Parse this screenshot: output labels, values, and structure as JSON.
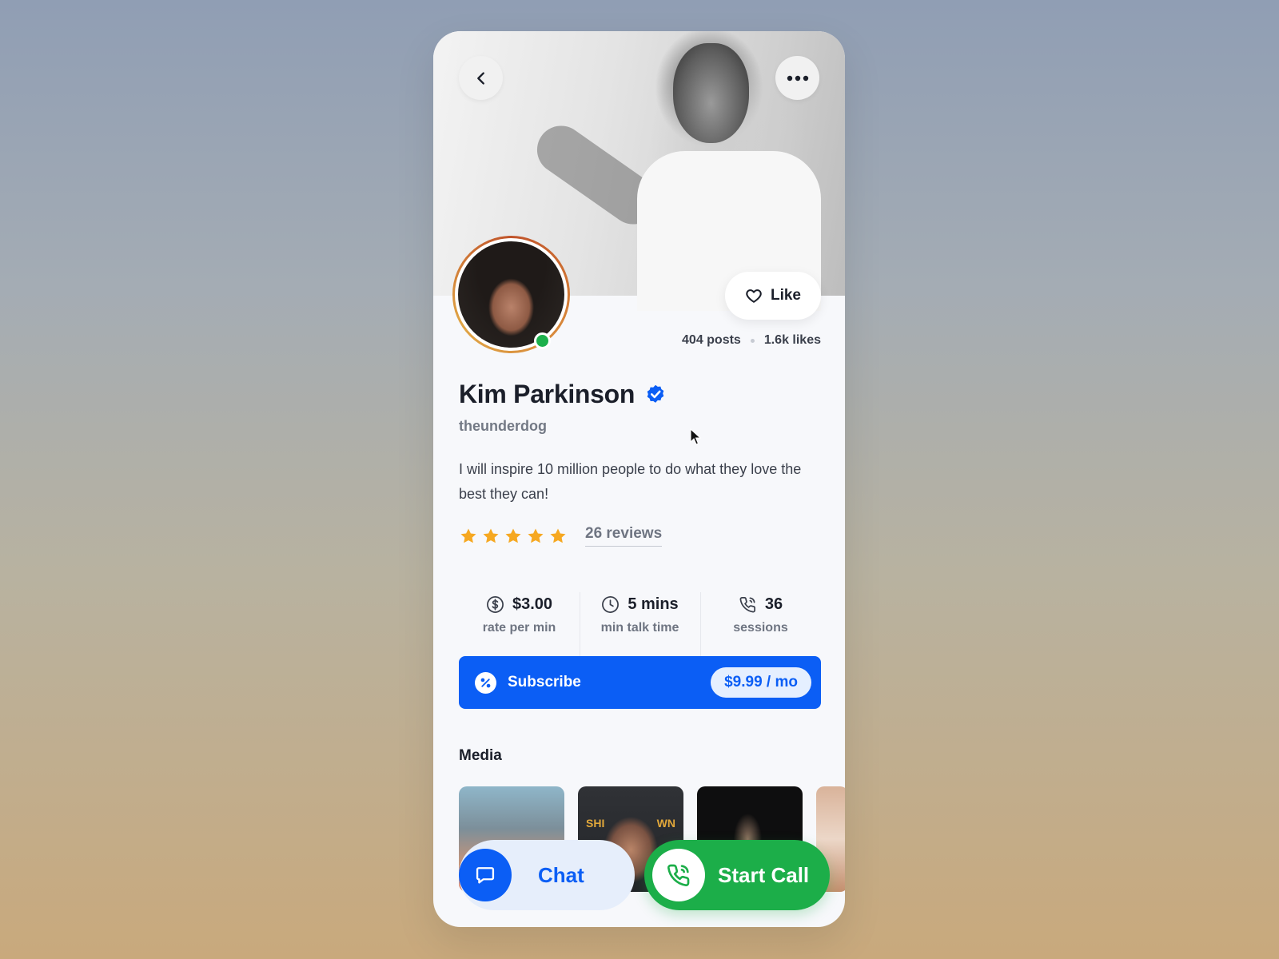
{
  "header": {
    "back_icon": "chevron-left-icon",
    "more_icon": "more-horizontal-icon"
  },
  "profile": {
    "name": "Kim Parkinson",
    "verified_icon": "verified-badge-icon",
    "handle": "theunderdog",
    "bio": "I will inspire 10 million people to do what they love the best they can!",
    "online": true,
    "like_label": "Like",
    "posts": "404 posts",
    "likes": "1.6k likes"
  },
  "rating": {
    "stars": 5,
    "max": 5,
    "reviews_label": "26 reviews"
  },
  "metrics": [
    {
      "icon": "dollar-circle-icon",
      "value": "$3.00",
      "label": "rate per min"
    },
    {
      "icon": "clock-icon",
      "value": "5 mins",
      "label": "min talk time"
    },
    {
      "icon": "phone-call-icon",
      "value": "36",
      "label": "sessions"
    }
  ],
  "subscribe": {
    "label": "Subscribe",
    "price": "$9.99 / mo",
    "icon": "percent-icon"
  },
  "media": {
    "title": "Media",
    "thumb2_sign_left": "SHI",
    "thumb2_sign_right": "WN"
  },
  "actions": {
    "chat_label": "Chat",
    "call_label": "Start Call"
  },
  "colors": {
    "accent": "#0b5ef5",
    "call_green": "#1cae49",
    "star": "#f6a821",
    "online": "#1cb04b"
  }
}
